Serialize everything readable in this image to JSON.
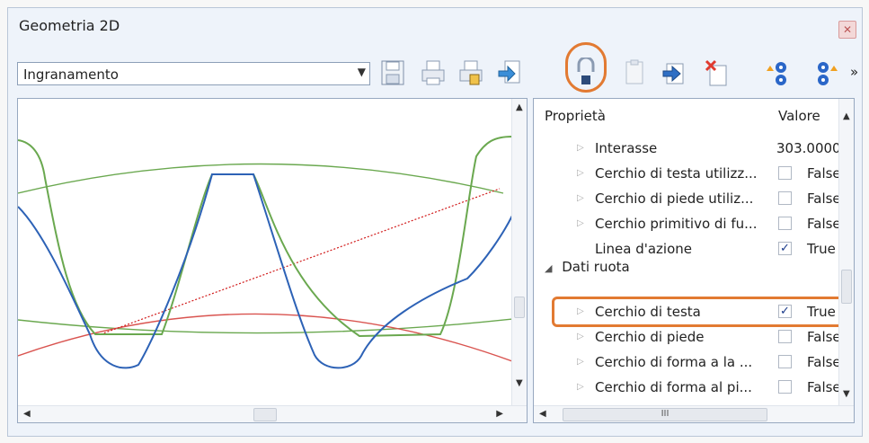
{
  "window": {
    "title": "Geometria 2D"
  },
  "toolbar": {
    "combo_value": "Ingranamento",
    "buttons": [
      "save-icon",
      "print-icon",
      "print-preview-icon",
      "export-icon",
      "lock-icon",
      "paste-icon",
      "add-icon",
      "delete-icon",
      "settings-up-icon",
      "settings-export-icon"
    ],
    "more_label": "»"
  },
  "properties": {
    "header_name": "Proprietà",
    "header_value": "Valore",
    "rows": [
      {
        "name": "Interasse",
        "value": "303.0000"
      },
      {
        "name": "Cerchio di testa utilizz...",
        "checked": false,
        "value": "False"
      },
      {
        "name": "Cerchio di piede utiliz...",
        "checked": false,
        "value": "False"
      },
      {
        "name": "Cerchio primitivo di fu...",
        "checked": false,
        "value": "False"
      },
      {
        "name": "Linea d'azione",
        "checked": true,
        "value": "True"
      }
    ],
    "group_label": "Dati ruota",
    "group_rows": [
      {
        "name": "Cerchio di testa",
        "checked": true,
        "value": "True"
      },
      {
        "name": "Cerchio di piede",
        "checked": false,
        "value": "False"
      },
      {
        "name": "Cerchio di forma a la ...",
        "checked": false,
        "value": "False"
      },
      {
        "name": "Cerchio di forma al pi...",
        "checked": false,
        "value": "False"
      }
    ],
    "hscroll_grip": "III"
  },
  "colors": {
    "accent_highlight": "#e27a32",
    "gear_green": "#6aa84f",
    "gear_blue": "#2d62b6",
    "circle_red": "#d9534f",
    "action_line": "#d11a1a"
  }
}
